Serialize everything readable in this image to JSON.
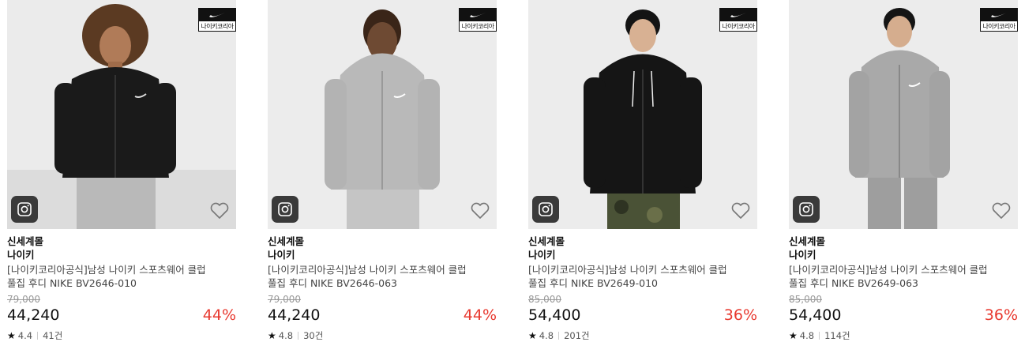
{
  "products": [
    {
      "badge_text": "나이키코리아",
      "store": "신세계몰",
      "brand": "나이키",
      "title": "[나이키코리아공식]남성 나이키 스포츠웨어 클럽 풀집 후디 NIKE BV2646-010",
      "original_price": "79,000",
      "price": "44,240",
      "discount": "44%",
      "rating": "4.4",
      "review_count": "41건",
      "hoodie_color": "#1a1a1a"
    },
    {
      "badge_text": "나이키코리아",
      "store": "신세계몰",
      "brand": "나이키",
      "title": "[나이키코리아공식]남성 나이키 스포츠웨어 클럽 풀집 후디 NIKE BV2646-063",
      "original_price": "79,000",
      "price": "44,240",
      "discount": "44%",
      "rating": "4.8",
      "review_count": "30건",
      "hoodie_color": "#b9b9b9"
    },
    {
      "badge_text": "나이키코리아",
      "store": "신세계몰",
      "brand": "나이키",
      "title": "[나이키코리아공식]남성 나이키 스포츠웨어 클럽 풀집 후디 NIKE BV2649-010",
      "original_price": "85,000",
      "price": "54,400",
      "discount": "36%",
      "rating": "4.8",
      "review_count": "201건",
      "hoodie_color": "#151515"
    },
    {
      "badge_text": "나이키코리아",
      "store": "신세계몰",
      "brand": "나이키",
      "title": "[나이키코리아공식]남성 나이키 스포츠웨어 클럽 풀집 후디 NIKE BV2649-063",
      "original_price": "85,000",
      "price": "54,400",
      "discount": "36%",
      "rating": "4.8",
      "review_count": "114건",
      "hoodie_color": "#a9a9a9"
    }
  ],
  "icons": {
    "instagram": "instagram-icon",
    "wishlist": "heart-icon",
    "brand_logo": "nike-swoosh-icon",
    "rating": "star-icon"
  },
  "colors": {
    "discount": "#e8392f",
    "badge_bg": "#111111"
  }
}
